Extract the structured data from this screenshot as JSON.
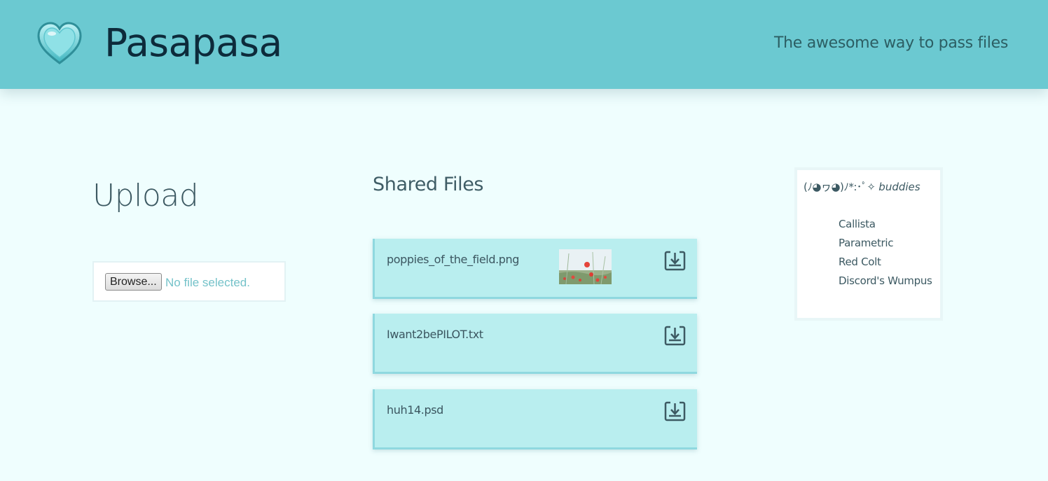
{
  "header": {
    "brand": "Pasapasa",
    "tagline": "The awesome way to pass files",
    "logo_icon": "heart-icon",
    "background_color": "#6bc9d1"
  },
  "upload": {
    "title": "Upload",
    "browse_label": "Browse...",
    "file_status": "No file selected."
  },
  "shared": {
    "title": "Shared Files",
    "files": [
      {
        "name": "poppies_of_the_field.png",
        "has_thumbnail": true,
        "icon": "download-icon"
      },
      {
        "name": "Iwant2bePILOT.txt",
        "has_thumbnail": false,
        "icon": "download-icon"
      },
      {
        "name": "huh14.psd",
        "has_thumbnail": false,
        "icon": "download-icon"
      }
    ]
  },
  "buddies": {
    "kaomoji": "(ﾉ◕ヮ◕)ﾉ*:･ﾟ✧",
    "title": "buddies",
    "list": [
      "Callista",
      "Parametric",
      "Red Colt",
      "Discord's Wumpus"
    ]
  },
  "colors": {
    "page_background": "#effefe",
    "card_background": "#b9eeef",
    "accent": "#6bc9d1",
    "text": "#3c5962"
  }
}
